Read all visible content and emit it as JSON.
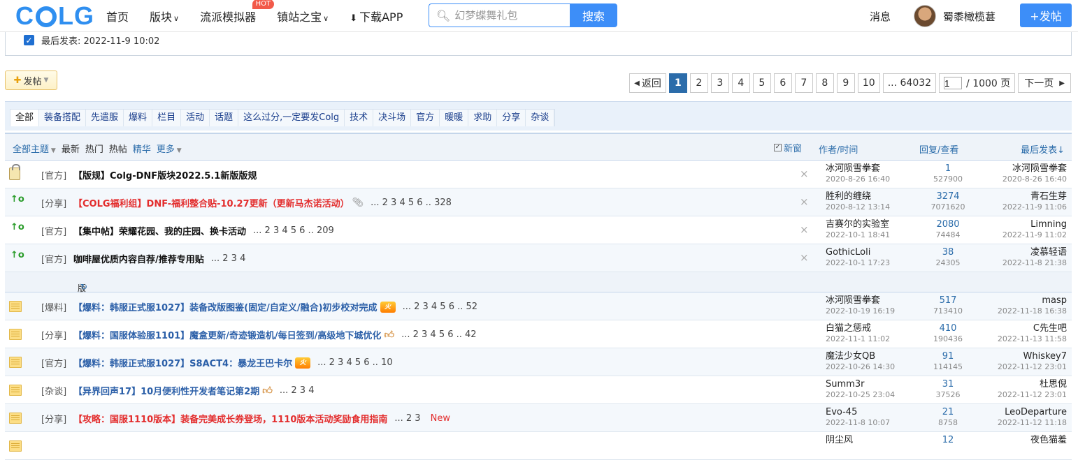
{
  "nav": {
    "logo": "COLG",
    "items": [
      {
        "label": "首页",
        "caret": false
      },
      {
        "label": "版块",
        "caret": true
      },
      {
        "label": "流派模拟器",
        "caret": false,
        "badge": "HOT"
      },
      {
        "label": "镇站之宝",
        "caret": true
      },
      {
        "label": "下载APP",
        "caret": false,
        "icon": "download-icon"
      }
    ],
    "search_placeholder": "幻梦蝶舞礼包",
    "search_button": "搜索",
    "messages": "消息",
    "username": "蜀黍橄榄葚",
    "post_button": "+发帖"
  },
  "filter": {
    "last_post_label": "最后发表: 2022-11-9 10:02"
  },
  "toolbar": {
    "post_label": "发帖",
    "back": "返回",
    "pages": [
      "1",
      "2",
      "3",
      "4",
      "5",
      "6",
      "7",
      "8",
      "9",
      "10"
    ],
    "last_page": "... 64032",
    "page_input": "1",
    "page_total": "/ 1000 页",
    "next": "下一页"
  },
  "categories": [
    "全部",
    "装备搭配",
    "先遣服",
    "爆料",
    "栏目",
    "活动",
    "话题",
    "这么过分,一定要发Colg",
    "技术",
    "决斗场",
    "官方",
    "暖暖",
    "求助",
    "分享",
    "杂谈"
  ],
  "thread_header": {
    "all_topics": "全部主题",
    "newest": "最新",
    "hot": "热门",
    "hot_posts": "热帖",
    "digest": "精华",
    "more": "更多",
    "new_window": "新窗",
    "author_time": "作者/时间",
    "reply_view": "回复/查看",
    "last_post": "最后发表↓"
  },
  "section_label": "版块主题",
  "threads": [
    {
      "icon": "lock",
      "tag": "[官方]",
      "title": "【版规】Colg-DNF版块2022.5.1新版版规",
      "color": "black",
      "pages": "",
      "author": "冰河陨雪拳套",
      "atime": "2020-8-26 16:40",
      "replies": "1",
      "views": "527900",
      "last": "冰河陨雪拳套",
      "ltime": "2020-8-26 16:40",
      "del": true
    },
    {
      "icon": "up",
      "tag": "[分享]",
      "title": "【COLG福利组】DNF-福利整合贴-10.27更新（更新马杰诺活动）",
      "color": "red",
      "clip": true,
      "pages": "... 2  3  4  5  6 .. 328",
      "author": "胜利的缠绕",
      "atime": "2020-8-12 13:14",
      "replies": "3274",
      "views": "7071620",
      "last": "青石生芽",
      "ltime": "2022-11-9 11:06",
      "del": true
    },
    {
      "icon": "up",
      "tag": "[官方]",
      "title": "【集中帖】荣耀花园、我的庄园、换卡活动",
      "color": "black",
      "pages": "... 2  3  4  5  6 .. 209",
      "author": "吉赛尔的实验室",
      "atime": "2022-10-1 18:41",
      "replies": "2080",
      "views": "74484",
      "last": "Limning",
      "ltime": "2022-11-9 11:02",
      "del": true
    },
    {
      "icon": "up",
      "tag": "[官方]",
      "title": "咖啡屋优质内容自荐/推荐专用贴",
      "color": "black",
      "pages": "... 2  3  4",
      "author": "GothicLoli",
      "atime": "2022-10-1 17:23",
      "replies": "38",
      "views": "24305",
      "last": "凌慕轻语",
      "ltime": "2022-11-8 21:38",
      "del": true
    },
    {
      "section": true
    },
    {
      "icon": "folder",
      "tag": "[爆料]",
      "title": "【爆料：韩服正式服1027】装备改版图鉴(固定/自定义/融合)初步校对完成",
      "color": "blue",
      "badge": "火",
      "pages": "... 2  3  4  5  6 .. 52",
      "author": "冰河陨雪拳套",
      "atime": "2022-10-19 16:19",
      "replies": "517",
      "views": "713410",
      "last": "masp",
      "ltime": "2022-11-18 16:38"
    },
    {
      "icon": "folder",
      "tag": "[分享]",
      "title": "【爆料：国服体验服1101】魔盒更新/奇迹锻造机/每日签到/高级地下城优化",
      "color": "blue",
      "thumb": true,
      "pages": "... 2  3  4  5  6 .. 42",
      "author": "白猫之惩戒",
      "atime": "2022-11-1 11:02",
      "replies": "410",
      "views": "190436",
      "last": "C先生吧",
      "ltime": "2022-11-13 11:58"
    },
    {
      "icon": "folder",
      "tag": "[官方]",
      "title": "【爆料：韩服正式服1027】S8ACT4：暴龙王巴卡尔",
      "color": "blue",
      "badge": "火",
      "pages": "... 2  3  4  5  6 .. 10",
      "author": "魔法少女QB",
      "atime": "2022-10-26 14:30",
      "replies": "91",
      "views": "114145",
      "last": "Whiskey7",
      "ltime": "2022-11-12 23:01"
    },
    {
      "icon": "folder",
      "tag": "[杂谈]",
      "title": "【异界回声17】10月便利性开发者笔记第2期",
      "color": "blue",
      "thumb": true,
      "pages": "... 2  3  4",
      "author": "Summ3r",
      "atime": "2022-10-25 23:04",
      "replies": "31",
      "views": "37526",
      "last": "杜思倪",
      "ltime": "2022-11-12 23:01"
    },
    {
      "icon": "folder",
      "tag": "[分享]",
      "title": "【攻略：国服1110版本】装备完美成长券登场，1110版本活动奖励食用指南",
      "color": "red",
      "pages": "... 2  3",
      "newtag": "New",
      "author": "Evo-45",
      "atime": "2022-11-8 10:07",
      "replies": "21",
      "views": "8758",
      "last": "LeoDeparture",
      "ltime": "2022-11-12 11:18"
    },
    {
      "icon": "folder",
      "tag": "",
      "title": "",
      "color": "red",
      "pages": "",
      "author": "阴尘风",
      "atime": "",
      "replies": "12",
      "views": "",
      "last": "夜色猫羞",
      "ltime": ""
    }
  ]
}
